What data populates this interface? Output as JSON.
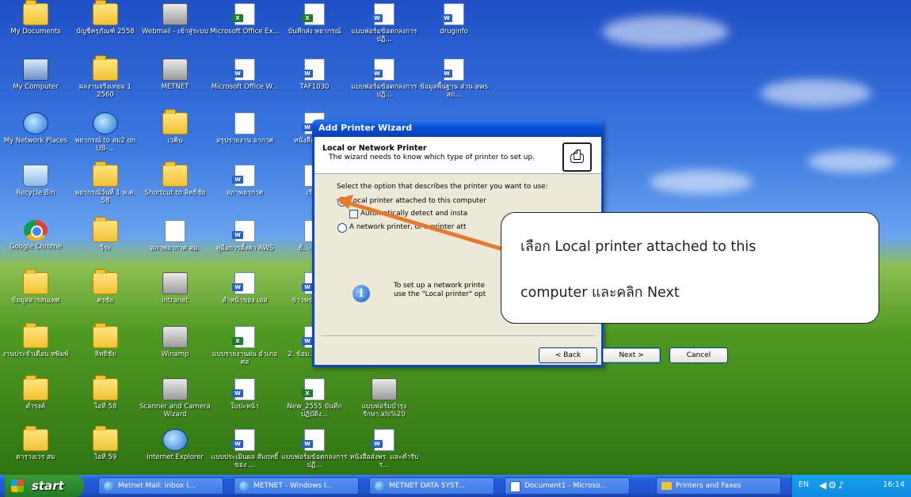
{
  "desktop": {
    "icons": [
      {
        "label": "My Documents",
        "type": "folder"
      },
      {
        "label": "บัญชีครุภัณฑ์ 2558",
        "type": "folder"
      },
      {
        "label": "Webmail - เข้าสู่ระบบ",
        "type": "misc"
      },
      {
        "label": "Microsoft Office Ex...",
        "type": "excel"
      },
      {
        "label": "บันทึกส่ง พยากรณ์",
        "type": "excel"
      },
      {
        "label": "แบบฟอร์มข้อตกลงการปฏิ...",
        "type": "word"
      },
      {
        "label": "druginfo",
        "type": "word"
      },
      {
        "label": "My Computer",
        "type": "pc"
      },
      {
        "label": "ผลงานจริงเทอม 1 2560",
        "type": "folder"
      },
      {
        "label": "METNET",
        "type": "misc"
      },
      {
        "label": "Microsoft Office W...",
        "type": "word"
      },
      {
        "label": "TAF1030",
        "type": "word"
      },
      {
        "label": "แบบฟอร์มข้อตกลงการปฏิ...",
        "type": "word"
      },
      {
        "label": "ข้อมูลพื้นฐาน ส่วน aws สถ...",
        "type": "word"
      },
      {
        "label": "My Network Places",
        "type": "globe"
      },
      {
        "label": "พยากรณ์ to สม2 on UB-...",
        "type": "globe"
      },
      {
        "label": "เวคีน",
        "type": "folder"
      },
      {
        "label": "สรุปรายงาน อากาศ",
        "type": "doc"
      },
      {
        "label": "หนังสือ ควา...",
        "type": "word"
      },
      {
        "label": "Recycle Bin",
        "type": "bin"
      },
      {
        "label": "พยากรณ์วันที่ 1 พ.ค. 58",
        "type": "folder"
      },
      {
        "label": "Shortcut to ลิทธิชัย",
        "type": "folder"
      },
      {
        "label": "สภาพอากาศ",
        "type": "word"
      },
      {
        "label": "เรีย...",
        "type": "doc"
      },
      {
        "label": "Google Chrome",
        "type": "chrome"
      },
      {
        "label": "วีระ",
        "type": "folder"
      },
      {
        "label": "สภาพอากาศ สม.",
        "type": "doc"
      },
      {
        "label": "คู่มือการตั้งค่า AWS",
        "type": "word"
      },
      {
        "label": "ยั่...-17กุ...",
        "type": "doc"
      },
      {
        "label": "ข้อมูลสารสนเทศ",
        "type": "folder"
      },
      {
        "label": "ศรชัย",
        "type": "folder"
      },
      {
        "label": "intranet",
        "type": "misc"
      },
      {
        "label": "ลำหน้าของ เอส",
        "type": "word"
      },
      {
        "label": "ข่าวพร... หน่วย",
        "type": "word"
      },
      {
        "label": "งานประจำเดือน ทพิมพ์",
        "type": "folder"
      },
      {
        "label": "ลิทธิชัย",
        "type": "folder"
      },
      {
        "label": "Winamp",
        "type": "misc"
      },
      {
        "label": "แบบรายงานฝน อำเภอ ศส",
        "type": "excel"
      },
      {
        "label": "2. ข้อม... ส่วนที่...",
        "type": "word"
      },
      {
        "label": "ดำรงค์",
        "type": "folder"
      },
      {
        "label": "โอที 58",
        "type": "folder"
      },
      {
        "label": "Scanner and Camera Wizard",
        "type": "misc"
      },
      {
        "label": "ใบปะหน้า",
        "type": "word"
      },
      {
        "label": "New_2555 บันทึกปฏิบัติง...",
        "type": "excel"
      },
      {
        "label": "แบบฟอร์มบำรุงรักษา.xls%20",
        "type": "misc"
      },
      {
        "label": "ตารางเวร สม",
        "type": "folder"
      },
      {
        "label": "โอที 59",
        "type": "folder"
      },
      {
        "label": "Internet Explorer",
        "type": "globe"
      },
      {
        "label": "แบบประเมินผล สัมฤทธิ์ของ ...",
        "type": "word"
      },
      {
        "label": "แบบฟอร์มข้อตกลงการปฏิ...",
        "type": "word"
      },
      {
        "label": "หนังสือส่งพร. และคำรับร...",
        "type": "word"
      }
    ]
  },
  "dialog": {
    "title": "Add Printer Wizard",
    "header_title": "Local or Network Printer",
    "header_subtitle": "The wizard needs to know which type of printer to set up.",
    "prompt": "Select the option that describes the printer you want to use:",
    "option_local": "Local printer attached to this computer",
    "option_auto": "Automatically detect and insta",
    "option_network": "A network printer, or a printer att",
    "info_line1": "To set up a network printe",
    "info_line2": "use the \"Local printer\" opt",
    "back_label": "< Back",
    "next_label": "Next >",
    "cancel_label": "Cancel",
    "selected_option": "local"
  },
  "callout": {
    "line1": "เลือก Local printer attached to this",
    "line2": "computer และคลิก Next",
    "arrow_color": "#e8792b"
  },
  "taskbar": {
    "start_label": "start",
    "tasks": [
      {
        "label": "Metnet Mail: Inbox (...",
        "icon": "browser-icon"
      },
      {
        "label": "METNET - Windows I...",
        "icon": "browser-icon"
      },
      {
        "label": "METNET DATA SYST...",
        "icon": "browser-icon"
      },
      {
        "label": "Document1 - Microso...",
        "icon": "word-icon"
      },
      {
        "label": "Printers and Faxes",
        "icon": "folder-icon"
      }
    ],
    "language": "EN",
    "clock": "16:14"
  }
}
